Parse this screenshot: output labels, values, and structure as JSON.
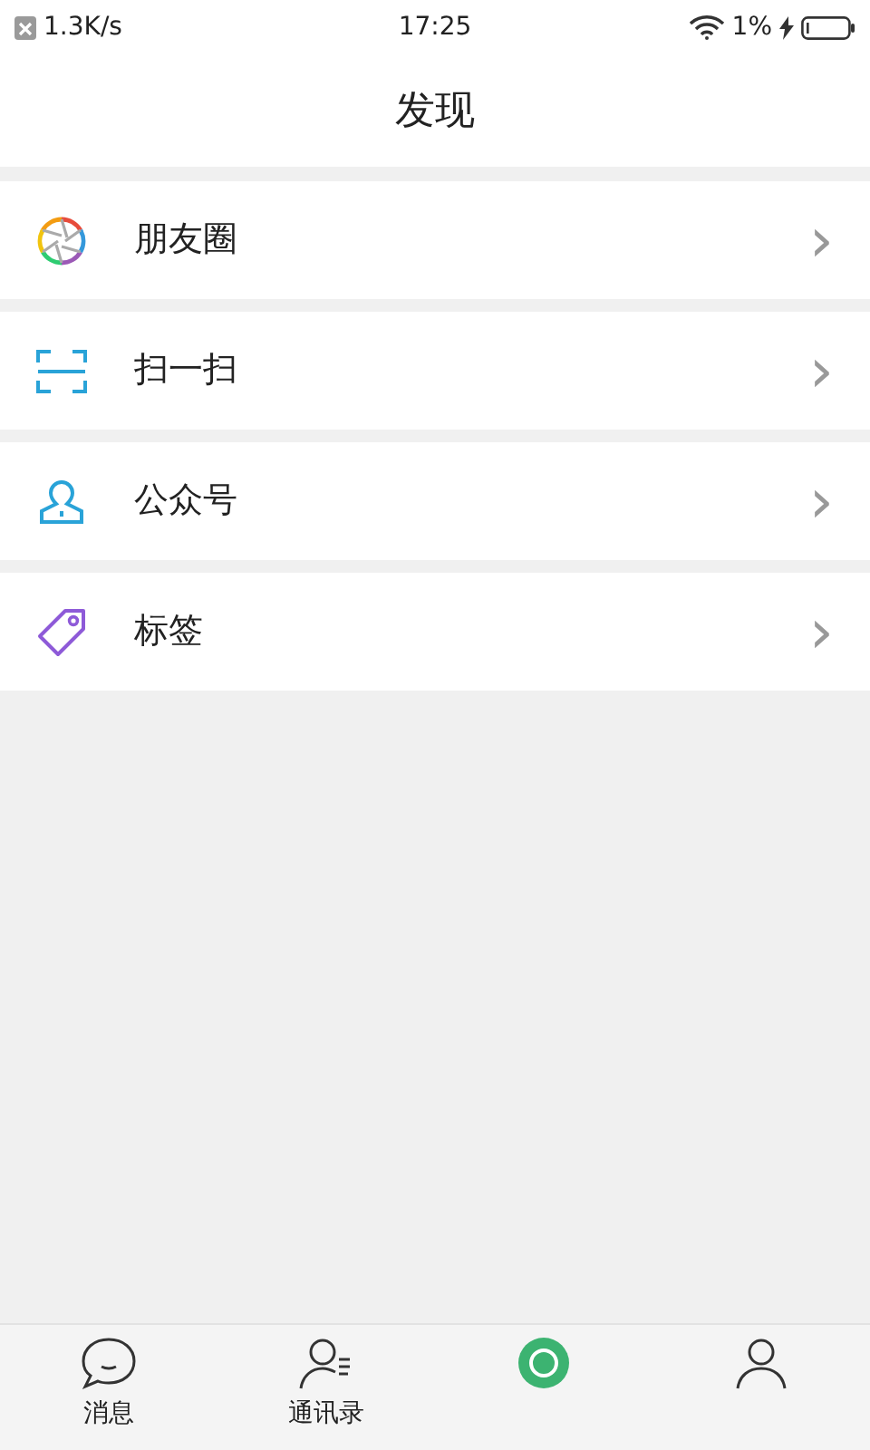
{
  "status_bar": {
    "speed": "1.3K/s",
    "time": "17:25",
    "battery": "1%"
  },
  "header": {
    "title": "发现"
  },
  "menu": [
    {
      "kind": "moments",
      "label": "朋友圈",
      "chevron": "›"
    },
    {
      "kind": "scan",
      "label": "扫一扫",
      "chevron": "›"
    },
    {
      "kind": "account",
      "label": "公众号",
      "chevron": "›"
    },
    {
      "kind": "tag",
      "label": "标签",
      "chevron": "›"
    }
  ],
  "tab_bar": [
    {
      "kind": "chat",
      "label": "消息",
      "selected": false
    },
    {
      "kind": "contacts",
      "label": "通讯录",
      "selected": false
    },
    {
      "kind": "discover",
      "selected": true
    },
    {
      "kind": "me",
      "selected": false
    }
  ]
}
